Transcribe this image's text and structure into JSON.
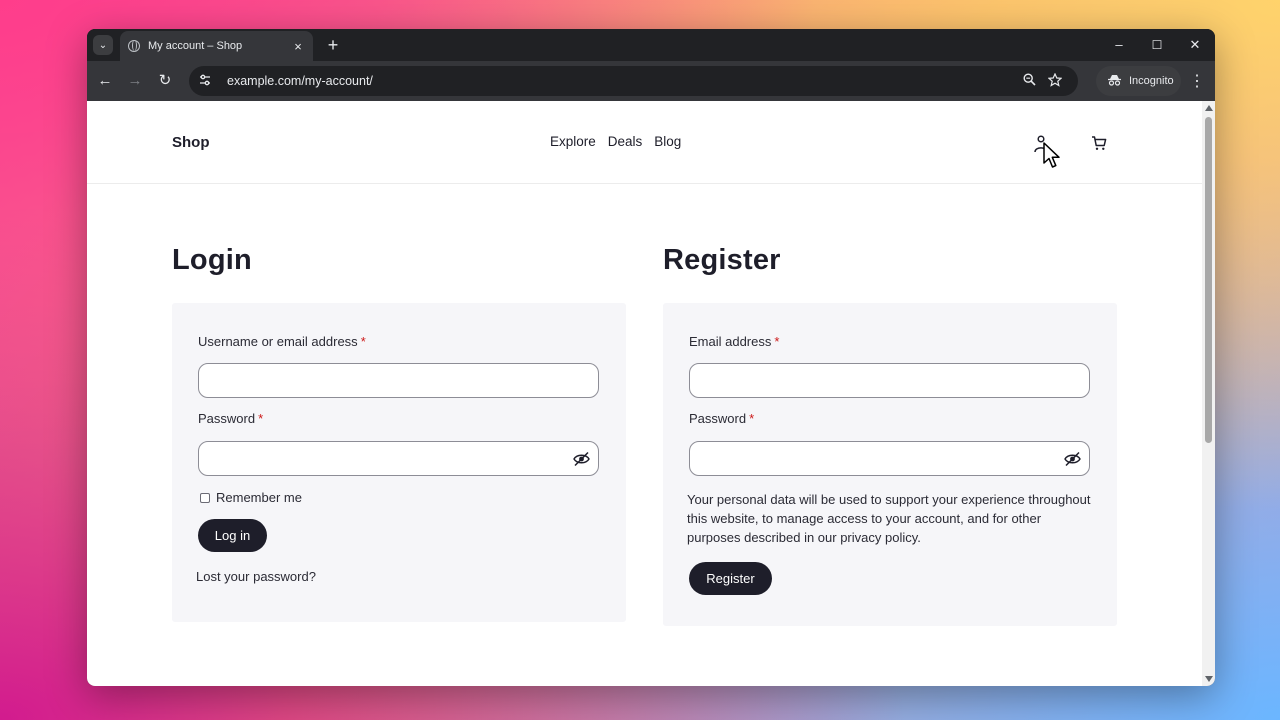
{
  "browser": {
    "tab_title": "My account – Shop",
    "tab_close": "×",
    "new_tab": "+",
    "url": "example.com/my-account/",
    "incognito_label": "Incognito",
    "window_controls": {
      "minimize": "–",
      "maximize": "☐",
      "close": "✕"
    },
    "nav": {
      "back": "←",
      "forward": "→",
      "reload": "↻"
    },
    "tab_list": "⌄",
    "menu": "⋮"
  },
  "site": {
    "brand": "Shop",
    "nav_items": [
      "Explore",
      "Deals",
      "Blog"
    ]
  },
  "login": {
    "heading": "Login",
    "username_label": "Username or email address",
    "password_label": "Password",
    "required_marker": "*",
    "remember_label": "Remember me",
    "submit_label": "Log in",
    "lost_password": "Lost your password?"
  },
  "register": {
    "heading": "Register",
    "email_label": "Email address",
    "password_label": "Password",
    "required_marker": "*",
    "privacy_text": "Your personal data will be used to support your experience throughout this website, to manage access to your account, and for other purposes described in our privacy policy.",
    "submit_label": "Register"
  },
  "colors": {
    "brand_dark": "#1e1e2a",
    "panel_bg": "#f6f6f9",
    "required": "#cc1818"
  }
}
